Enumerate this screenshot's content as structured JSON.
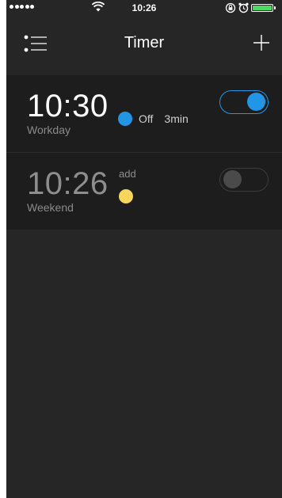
{
  "status_bar": {
    "time": "10:26",
    "signal_bars": 5,
    "icons": [
      "signal-dots-icon",
      "wifi-icon",
      "orientation-lock-icon",
      "alarm-icon",
      "battery-icon"
    ],
    "battery_color": "#4cd964"
  },
  "nav": {
    "title": "Timer",
    "left_icon": "list-menu-icon",
    "right_icon": "plus-icon"
  },
  "timers": [
    {
      "time": "10:30",
      "repeat": "Workday",
      "color": "#2196e6",
      "action": "Off",
      "duration": "3min",
      "enabled": true
    },
    {
      "time": "10:26",
      "repeat": "Weekend",
      "color": "#f7d65a",
      "action_label": "add",
      "enabled": false
    }
  ],
  "colors": {
    "background": "#262626",
    "row_background": "#1d1d1d",
    "accent": "#2196e6"
  }
}
